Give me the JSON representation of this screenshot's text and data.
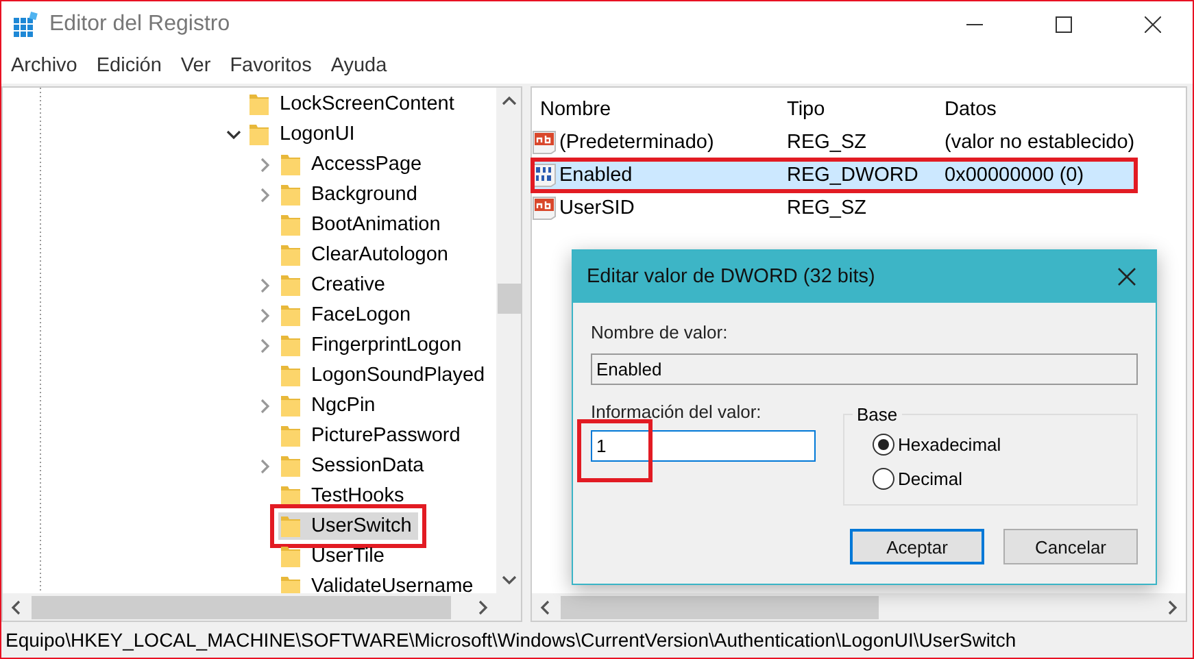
{
  "window": {
    "title": "Editor del Registro"
  },
  "menu": [
    "Archivo",
    "Edición",
    "Ver",
    "Favoritos",
    "Ayuda"
  ],
  "tree": [
    {
      "label": "LockScreenContent",
      "has_children": false,
      "selected": false,
      "highlighted": false
    },
    {
      "label": "LogonUI",
      "has_children": true,
      "expanded": true,
      "selected": false,
      "highlighted": false,
      "children": [
        {
          "label": "AccessPage",
          "has_children": true,
          "expanded": false,
          "selected": false,
          "highlighted": false
        },
        {
          "label": "Background",
          "has_children": true,
          "expanded": false,
          "selected": false,
          "highlighted": false
        },
        {
          "label": "BootAnimation",
          "has_children": false,
          "selected": false,
          "highlighted": false
        },
        {
          "label": "ClearAutologon",
          "has_children": false,
          "selected": false,
          "highlighted": false
        },
        {
          "label": "Creative",
          "has_children": true,
          "expanded": false,
          "selected": false,
          "highlighted": false
        },
        {
          "label": "FaceLogon",
          "has_children": true,
          "expanded": false,
          "selected": false,
          "highlighted": false
        },
        {
          "label": "FingerprintLogon",
          "has_children": true,
          "expanded": false,
          "selected": false,
          "highlighted": false
        },
        {
          "label": "LogonSoundPlayed",
          "has_children": false,
          "selected": false,
          "highlighted": false
        },
        {
          "label": "NgcPin",
          "has_children": true,
          "expanded": false,
          "selected": false,
          "highlighted": false
        },
        {
          "label": "PicturePassword",
          "has_children": false,
          "selected": false,
          "highlighted": false
        },
        {
          "label": "SessionData",
          "has_children": true,
          "expanded": false,
          "selected": false,
          "highlighted": false
        },
        {
          "label": "TestHooks",
          "has_children": false,
          "selected": false,
          "highlighted": false
        },
        {
          "label": "UserSwitch",
          "has_children": false,
          "selected": true,
          "highlighted": true
        },
        {
          "label": "UserTile",
          "has_children": false,
          "selected": false,
          "highlighted": false
        },
        {
          "label": "ValidateUsername",
          "has_children": false,
          "selected": false,
          "highlighted": false
        }
      ]
    }
  ],
  "values": {
    "columns": [
      "Nombre",
      "Tipo",
      "Datos"
    ],
    "rows": [
      {
        "name": "(Predeterminado)",
        "kind": "string",
        "type": "REG_SZ",
        "data": "(valor no establecido)",
        "selected": false,
        "highlighted": false
      },
      {
        "name": "Enabled",
        "kind": "binary",
        "type": "REG_DWORD",
        "data": "0x00000000 (0)",
        "selected": true,
        "highlighted": true
      },
      {
        "name": "UserSID",
        "kind": "string",
        "type": "REG_SZ",
        "selected": false,
        "highlighted": false
      }
    ]
  },
  "dialog": {
    "title": "Editar valor de DWORD (32 bits)",
    "name_label": "Nombre de valor:",
    "name_value": "Enabled",
    "data_label": "Información del valor:",
    "data_value": "1",
    "data_highlighted": true,
    "base_label": "Base",
    "radios": [
      {
        "label": "Hexadecimal",
        "selected": true
      },
      {
        "label": "Decimal",
        "selected": false
      }
    ],
    "buttons": [
      {
        "label": "Aceptar",
        "default": true
      },
      {
        "label": "Cancelar",
        "default": false
      }
    ]
  },
  "status_bar": "Equipo\\HKEY_LOCAL_MACHINE\\SOFTWARE\\Microsoft\\Windows\\CurrentVersion\\Authentication\\LogonUI\\UserSwitch"
}
